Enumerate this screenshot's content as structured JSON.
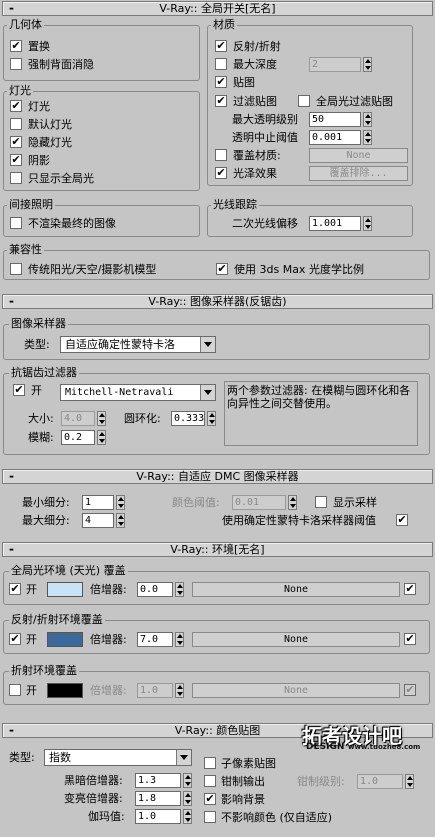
{
  "p1": {
    "sign": "-",
    "title": "V-Ray:: 全局开关[无名]",
    "geom": {
      "label": "几何体",
      "displacement": "置换",
      "force_back": "强制背面消隐"
    },
    "lights": {
      "label": "灯光",
      "lights": "灯光",
      "default_lights": "默认灯光",
      "hidden_lights": "隐藏灯光",
      "shadows": "阴影",
      "show_gi_only": "只显示全局光"
    },
    "indirect": {
      "label": "间接照明",
      "dont_render_final": "不渲染最终的图像"
    },
    "mat": {
      "label": "材质",
      "reflect_refract": "反射/折射",
      "max_depth": "最大深度",
      "max_depth_val": "2",
      "maps": "贴图",
      "filter_maps": "过滤贴图",
      "gi_filter_maps": "全局光过滤贴图",
      "max_transp": "最大透明级别",
      "max_transp_val": "50",
      "transp_cutoff": "透明中止阈值",
      "transp_cutoff_val": "0.001",
      "override_mtl": "覆盖材质:",
      "override_btn": "None",
      "glossy": "光泽效果",
      "glossy_btn": "覆盖排除..."
    },
    "raytrace": {
      "label": "光线跟踪",
      "secondary_bias": "二次光线偏移",
      "secondary_bias_val": "1.001"
    },
    "compat": {
      "label": "兼容性",
      "legacy": "传统阳光/天空/摄影机模型",
      "use_3ds": "使用 3ds Max 光度学比例"
    }
  },
  "p2": {
    "sign": "-",
    "title": "V-Ray:: 图像采样器(反锯齿)",
    "sampler": {
      "label": "图像采样器",
      "type_label": "类型:",
      "type_val": "自适应确定性蒙特卡洛"
    },
    "aa": {
      "label": "抗锯齿过滤器",
      "on": "开",
      "filter": "Mitchell-Netravali",
      "desc": "两个参数过滤器: 在模糊与圆环化和各向异性之间交替使用。",
      "size_label": "大小:",
      "size_val": "4.0",
      "ring_label": "圆环化:",
      "ring_val": "0.333",
      "blur_label": "模糊:",
      "blur_val": "0.2"
    }
  },
  "p3": {
    "sign": "-",
    "title": "V-Ray:: 自适应 DMC 图像采样器",
    "min_sub": "最小细分:",
    "min_sub_val": "1",
    "max_sub": "最大细分:",
    "max_sub_val": "4",
    "clr_thresh": "颜色阈值:",
    "clr_thresh_val": "0.01",
    "show_samples": "显示采样",
    "use_dmc": "使用确定性蒙特卡洛采样器阈值"
  },
  "p4": {
    "sign": "-",
    "title": "V-Ray:: 环境[无名]",
    "gi_env": {
      "label": "全局光环境 (天光) 覆盖",
      "on": "开",
      "mult_label": "倍增器:",
      "mult_val": "0.0",
      "map": "None",
      "color": "#c8e2f8"
    },
    "refl_env": {
      "label": "反射/折射环境覆盖",
      "on": "开",
      "mult_label": "倍增器:",
      "mult_val": "7.0",
      "map": "None",
      "color": "#3a6a9c"
    },
    "refr_env": {
      "label": "折射环境覆盖",
      "on": "开",
      "mult_label": "倍增器:",
      "mult_val": "1.0",
      "map": "None",
      "color": "#000000"
    }
  },
  "p5": {
    "sign": "-",
    "title": "V-Ray:: 颜色贴图",
    "type_label": "类型:",
    "type_val": "指数",
    "dark_label": "黑暗倍增器:",
    "dark_val": "1.3",
    "bright_label": "变亮倍增器:",
    "bright_val": "1.8",
    "gamma_label": "伽玛值:",
    "gamma_val": "1.0",
    "subpixel": "子像素贴图",
    "clamp": "钳制输出",
    "clamp_level": "钳制级别:",
    "clamp_level_val": "1.0",
    "affect_bg": "影响背景",
    "no_affect": "不影响颜色 (仅自适应)"
  },
  "watermark": {
    "line1": "拓者设计吧",
    "line2": "DESIGN",
    "line3": "www.tuozhe8.com"
  },
  "check": "✔"
}
